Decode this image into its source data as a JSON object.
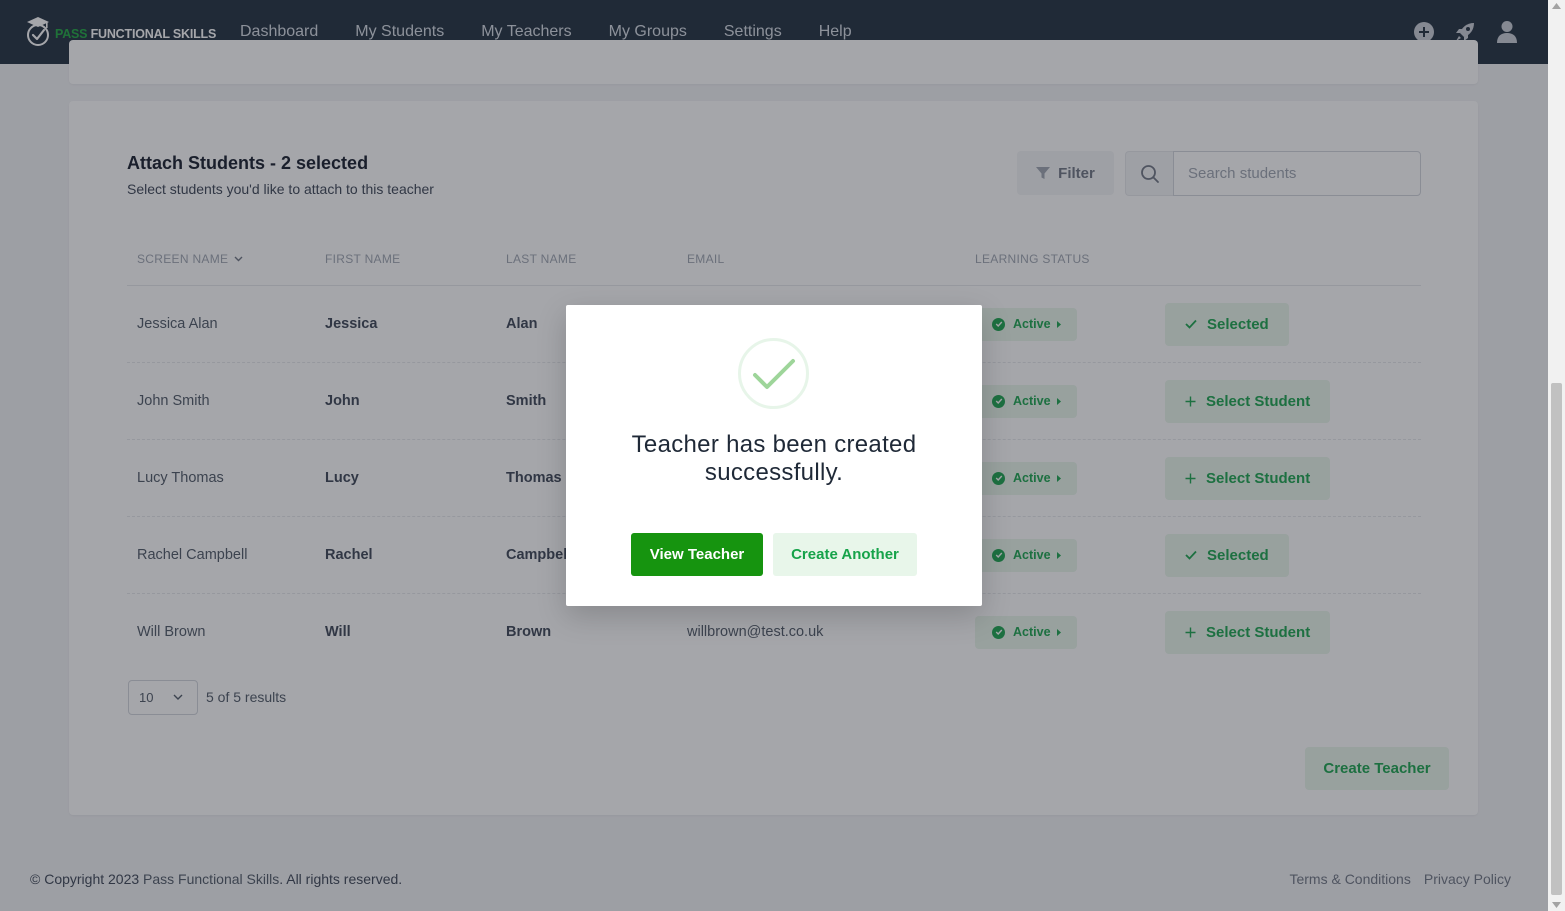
{
  "colors": {
    "nav_bg": "#1b2a3a",
    "brand_green": "#16a34a",
    "primary_button": "#16940f",
    "soft_green": "#e8f6ea"
  },
  "brand": {
    "part1": "PASS",
    "part2": "FUNCTIONAL SKILLS"
  },
  "nav": {
    "items": [
      {
        "label": "Dashboard"
      },
      {
        "label": "My Students"
      },
      {
        "label": "My Teachers"
      },
      {
        "label": "My Groups"
      },
      {
        "label": "Settings"
      },
      {
        "label": "Help"
      }
    ],
    "icons": [
      "plus-circle-icon",
      "rocket-icon",
      "user-icon"
    ]
  },
  "attach": {
    "title": "Attach Students - 2 selected",
    "subtitle": "Select students you'd like to attach to this teacher",
    "filter_label": "Filter",
    "search_placeholder": "Search students"
  },
  "table": {
    "headers": {
      "screen_name": "SCREEN NAME",
      "first_name": "FIRST NAME",
      "last_name": "LAST NAME",
      "email": "EMAIL",
      "learning_status": "LEARNING STATUS"
    },
    "rows": [
      {
        "screen_name": "Jessica Alan",
        "first_name": "Jessica",
        "last_name": "Alan",
        "email": "",
        "status": "Active",
        "action": "Selected",
        "selected": true
      },
      {
        "screen_name": "John Smith",
        "first_name": "John",
        "last_name": "Smith",
        "email": "",
        "status": "Active",
        "action": "Select Student",
        "selected": false
      },
      {
        "screen_name": "Lucy Thomas",
        "first_name": "Lucy",
        "last_name": "Thomas",
        "email": "",
        "status": "Active",
        "action": "Select Student",
        "selected": false
      },
      {
        "screen_name": "Rachel Campbell",
        "first_name": "Rachel",
        "last_name": "Campbell",
        "email": "",
        "status": "Active",
        "action": "Selected",
        "selected": true
      },
      {
        "screen_name": "Will Brown",
        "first_name": "Will",
        "last_name": "Brown",
        "email": "willbrown@test.co.uk",
        "status": "Active",
        "action": "Select Student",
        "selected": false
      }
    ]
  },
  "pagination": {
    "per_page": "10",
    "results": "5 of 5 results"
  },
  "create_teacher_label": "Create Teacher",
  "footer": {
    "copyright_prefix": "© Copyright 2023 ",
    "brand": "Pass Functional Skills",
    "copyright_suffix": ". All rights reserved.",
    "links": [
      "Terms & Conditions",
      "Privacy Policy"
    ]
  },
  "modal": {
    "message": "Teacher has been created successfully.",
    "view_button": "View Teacher",
    "create_another_button": "Create Another"
  }
}
